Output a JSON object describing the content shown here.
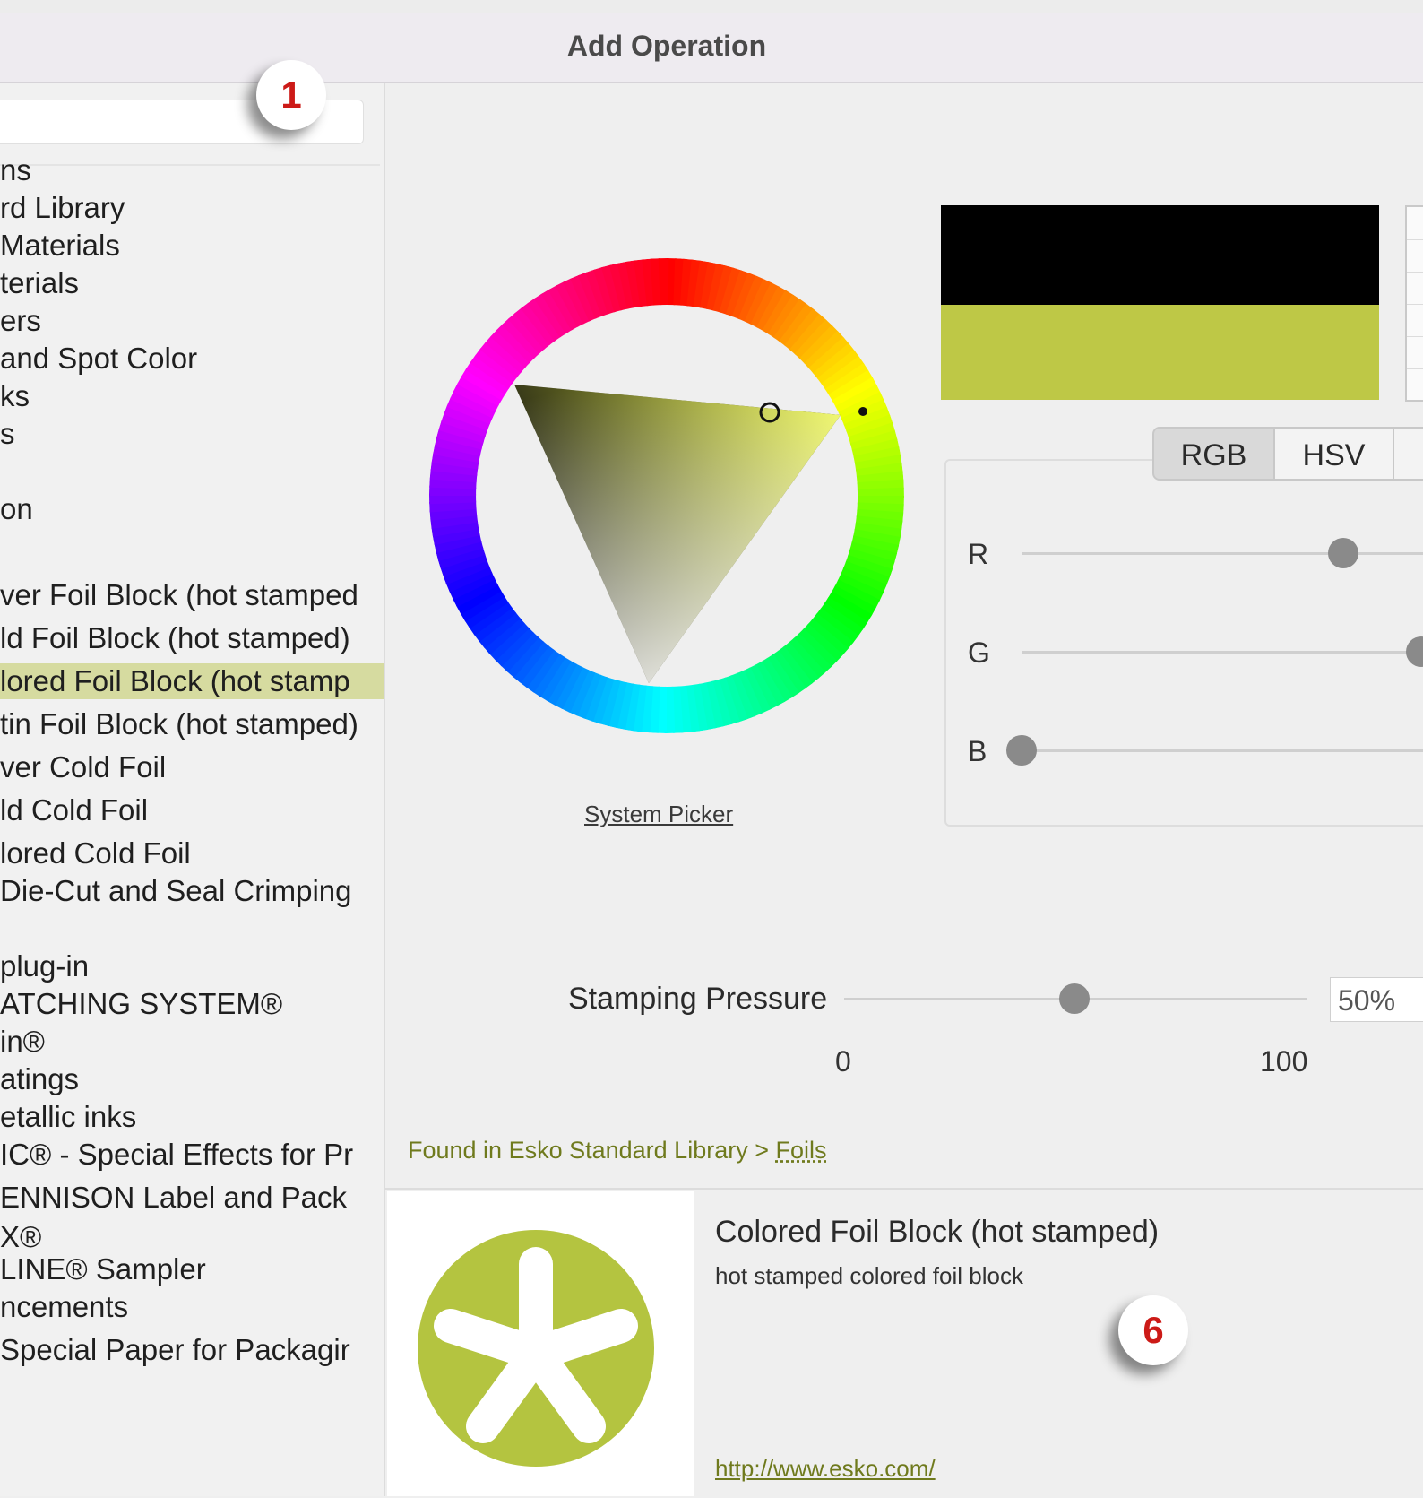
{
  "window": {
    "title": "Add Operation"
  },
  "callouts": {
    "one": "1",
    "six": "6"
  },
  "library_list": [
    "ns",
    "rd Library",
    " Materials",
    "terials",
    "ers",
    "and Spot Color",
    "ks",
    "s",
    "",
    "on",
    "",
    "ver Foil Block (hot stamped",
    "ld Foil Block (hot stamped)",
    "lored Foil Block (hot stamp",
    "tin Foil Block (hot stamped)",
    "ver Cold Foil",
    "ld Cold Foil",
    "lored Cold Foil",
    "Die-Cut and Seal Crimping",
    "",
    "plug-in",
    "ATCHING SYSTEM®",
    "in®",
    "atings",
    "etallic inks",
    "IC® - Special Effects for Pr",
    "ENNISON Label and Pack",
    "X®",
    " LINE® Sampler",
    "ncements",
    " Special Paper for Packagir"
  ],
  "library_selected_index": 13,
  "color_picker": {
    "system_picker_label": "System Picker",
    "old_color": "#000000",
    "new_color": "#bec846",
    "tabs": [
      "RGB",
      "HSV"
    ],
    "active_tab": "RGB",
    "channels": [
      {
        "label": "R",
        "level": 0.78
      },
      {
        "label": "G",
        "level": 0.97
      },
      {
        "label": "B",
        "level": 0.0
      }
    ]
  },
  "stamping_pressure": {
    "label": "Stamping Pressure",
    "value": "50%",
    "level": 0.5,
    "min_label": "0",
    "max_label": "100"
  },
  "found_in": {
    "prefix": "Found in Esko Standard Library > ",
    "link": "Foils"
  },
  "info": {
    "title": "Colored Foil Block (hot stamped)",
    "description": "hot stamped colored foil block",
    "link": "http://www.esko.com/",
    "logo_color": "#b4c440"
  }
}
